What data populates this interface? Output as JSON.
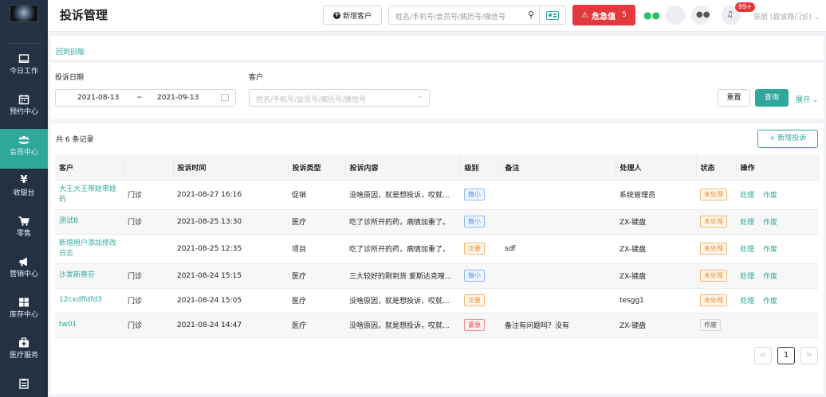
{
  "header": {
    "title": "投诉管理",
    "new_customer_label": "新增客户",
    "search_placeholder": "姓名/手机号/会员号/病历号/微信号",
    "emergency_label": "危急值",
    "emergency_count": "5",
    "notification_badge": "99+",
    "user_name": "张朋 (碧波路门诊)"
  },
  "sidebar": {
    "items": [
      {
        "label": "今日工作",
        "icon": "monitor-icon"
      },
      {
        "label": "预约中心",
        "icon": "calendar-icon"
      },
      {
        "label": "会员中心",
        "icon": "users-icon"
      },
      {
        "label": "收银台",
        "icon": "yen-icon"
      },
      {
        "label": "零售",
        "icon": "cart-icon"
      },
      {
        "label": "营销中心",
        "icon": "megaphone-icon"
      },
      {
        "label": "库存中心",
        "icon": "grid-icon"
      },
      {
        "label": "医疗服务",
        "icon": "medkit-icon"
      }
    ]
  },
  "back_link": "回到旧版",
  "filters": {
    "date_label": "投诉日期",
    "date_start": "2021-08-13",
    "date_sep": "~",
    "date_end": "2021-09-13",
    "customer_label": "客户",
    "customer_placeholder": "姓名/手机号/会员号/病历号/微信号",
    "reset_label": "重置",
    "query_label": "查询",
    "expand_label": "展开"
  },
  "list": {
    "record_count": "共 6 条记录",
    "add_label": "+ 新增投诉",
    "columns": [
      "客户",
      "",
      "投诉时间",
      "投诉类型",
      "投诉内容",
      "级别",
      "备注",
      "处理人",
      "状态",
      "操作"
    ],
    "rows": [
      {
        "customer": "大王大王带娃带娃的",
        "clinic": "门诊",
        "time": "2021-08-27 16:16",
        "type": "促销",
        "content": "没啥原因，就是想投诉，哎就...",
        "level": "微小",
        "level_color": "blue",
        "note": "",
        "handler": "系统管理员",
        "status": "未处理",
        "status_color": "orange",
        "actions": [
          "处理",
          "作废"
        ]
      },
      {
        "customer": "测试B",
        "clinic": "门诊",
        "time": "2021-08-25 13:30",
        "type": "医疗",
        "content": "吃了诊所开的药，病情加重了。",
        "level": "微小",
        "level_color": "blue",
        "note": "",
        "handler": "ZX-键盘",
        "status": "未处理",
        "status_color": "orange",
        "actions": [
          "处理",
          "作废"
        ]
      },
      {
        "customer": "新增用户添加修改日志",
        "clinic": "",
        "time": "2021-08-25 12:35",
        "type": "项目",
        "content": "吃了诊所开的药，病情加重了。",
        "level": "次要",
        "level_color": "orange",
        "note": "sdf",
        "handler": "ZX-键盘",
        "status": "未处理",
        "status_color": "orange",
        "actions": [
          "处理",
          "作废"
        ]
      },
      {
        "customer": "沙发斯蒂芬",
        "clinic": "门诊",
        "time": "2021-08-24 15:15",
        "type": "医疗",
        "content": "三大较好的刚到货 爱斯达克嗖...",
        "level": "微小",
        "level_color": "blue",
        "note": "",
        "handler": "ZX-键盘",
        "status": "未处理",
        "status_color": "orange",
        "actions": [
          "处理",
          "作废"
        ]
      },
      {
        "customer": "12cxdffdfd3",
        "clinic": "门诊",
        "time": "2021-08-24 15:05",
        "type": "医疗",
        "content": "没啥原因，就是想投诉，哎就...",
        "level": "次要",
        "level_color": "orange",
        "note": "",
        "handler": "tesgg1",
        "status": "未处理",
        "status_color": "orange",
        "actions": [
          "处理",
          "作废"
        ]
      },
      {
        "customer": "tw01",
        "clinic": "门诊",
        "time": "2021-08-24 14:47",
        "type": "医疗",
        "content": "没啥原因，就是想投诉，哎就...",
        "level": "紧急",
        "level_color": "red",
        "note": "备注有问题吗？没有",
        "handler": "ZX-键盘",
        "status": "作废",
        "status_color": "gray",
        "actions": []
      }
    ]
  },
  "pagination": {
    "prev": "<",
    "current": "1",
    "next": ">"
  }
}
